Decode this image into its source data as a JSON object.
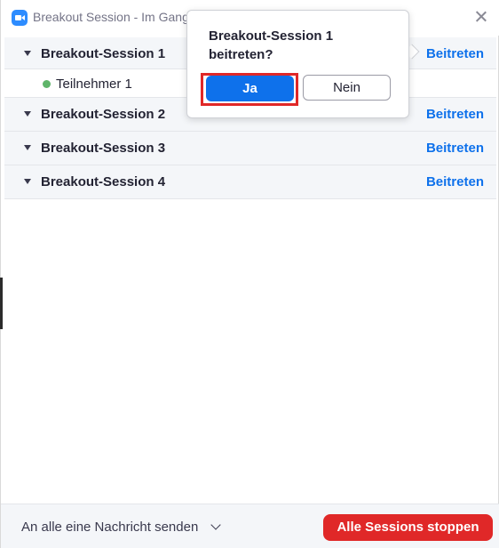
{
  "window": {
    "title": "Breakout Session - Im Gang",
    "app_icon": "zoom-camera-icon",
    "close_icon": "close-icon"
  },
  "sessions": [
    {
      "name": "Breakout-Session 1",
      "join_label": "Beitreten",
      "participants": [
        "Teilnehmer 1"
      ]
    },
    {
      "name": "Breakout-Session 2",
      "join_label": "Beitreten"
    },
    {
      "name": "Breakout-Session 3",
      "join_label": "Beitreten"
    },
    {
      "name": "Breakout-Session 4",
      "join_label": "Beitreten"
    }
  ],
  "popover": {
    "question_line1": "Breakout-Session 1",
    "question_line2": "beitreten?",
    "yes_label": "Ja",
    "no_label": "Nein"
  },
  "footer": {
    "message_label": "An alle eine Nachricht senden",
    "stop_label": "Alle Sessions stoppen"
  },
  "colors": {
    "accent_blue": "#0e71eb",
    "stop_red": "#e02828",
    "highlight_red": "#e02828",
    "status_green": "#5fb56a"
  }
}
